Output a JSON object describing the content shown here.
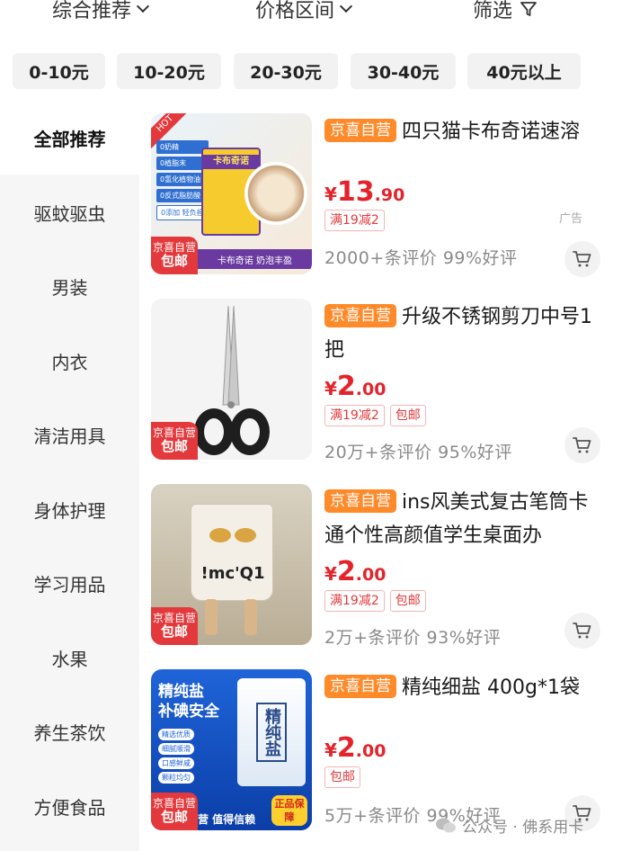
{
  "sort_bar": {
    "items": [
      "综合推荐",
      "价格区间",
      "筛选"
    ]
  },
  "price_chips": [
    "0-10元",
    "10-20元",
    "20-30元",
    "30-40元",
    "40元以上"
  ],
  "sidebar": {
    "items": [
      "全部推荐",
      "驱蚊驱虫",
      "男装",
      "内衣",
      "清洁用具",
      "身体护理",
      "学习用品",
      "水果",
      "养生茶饮",
      "方便食品"
    ],
    "active_index": 0
  },
  "products": [
    {
      "self_tag": "京喜自营",
      "title": "四只猫卡布奇诺速溶",
      "price_yen": "¥",
      "price_int": "13",
      "price_dec": ".90",
      "promos": [
        "满19减2"
      ],
      "reviews": "2000+条评价  99%好评",
      "ad": "广告",
      "thumb_badge_top": "京喜自营",
      "thumb_badge_bottom": "包邮",
      "thumb_text": [
        "0奶精",
        "0植脂末",
        "0氢化植物油",
        "0反式脂肪酸",
        "0添加 轻负担"
      ],
      "thumb_box_title": "卡布奇诺",
      "thumb_box_sub": "卡布奇诺 奶泡丰盈",
      "thumb_hot": "HOT"
    },
    {
      "self_tag": "京喜自营",
      "title": "升级不锈钢剪刀中号1把",
      "price_yen": "¥",
      "price_int": "2",
      "price_dec": ".00",
      "promos": [
        "满19减2",
        "包邮"
      ],
      "reviews": "20万+条评价  95%好评",
      "thumb_badge_top": "京喜自营",
      "thumb_badge_bottom": "包邮"
    },
    {
      "self_tag": "京喜自营",
      "title": "ins风美式复古笔筒卡通个性高颜值学生桌面办",
      "price_yen": "¥",
      "price_int": "2",
      "price_dec": ".00",
      "promos": [
        "满19减2",
        "包邮"
      ],
      "reviews": "2万+条评价  93%好评",
      "thumb_badge_top": "京喜自营",
      "thumb_badge_bottom": "包邮",
      "thumb_cup_text": "!mc'Q1"
    },
    {
      "self_tag": "京喜自营",
      "title": "精纯细盐 400g*1袋",
      "price_yen": "¥",
      "price_int": "2",
      "price_dec": ".00",
      "promos": [
        "包邮"
      ],
      "reviews": "5万+条评价  99%好评",
      "thumb_badge_top": "京喜自营",
      "thumb_badge_bottom": "包邮",
      "thumb_heading_1": "精纯盐",
      "thumb_heading_2": "补碘安全",
      "thumb_list": [
        "精选优质",
        "细腻顺滑",
        "口感鲜咸",
        "颗粒均匀"
      ],
      "thumb_bag": "精纯盐",
      "thumb_stamp": "正品保障",
      "thumb_footer": "营 值得信赖"
    }
  ],
  "watermark": "公众号 · 佛系用卡",
  "colors": {
    "accent_red": "#e4232b",
    "self_tag_orange": "#ff8a2a",
    "sidebar_bg": "#f6f6f6"
  }
}
